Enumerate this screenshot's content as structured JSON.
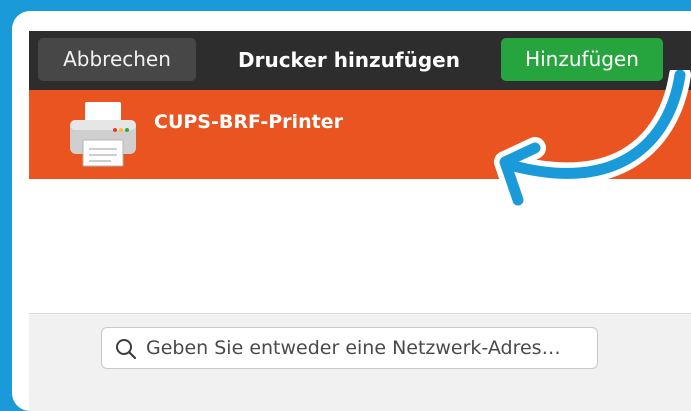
{
  "dialog": {
    "title": "Drucker hinzufügen",
    "cancel_label": "Abbrechen",
    "add_label": "Hinzufügen"
  },
  "printers": [
    {
      "name": "CUPS-BRF-Printer",
      "selected": true,
      "icon": "printer-icon"
    }
  ],
  "search": {
    "placeholder": "Geben Sie entweder eine Netzwerk-Adres…"
  },
  "colors": {
    "background": "#1a9ad9",
    "headerbar": "#2d2d2d",
    "selection": "#e95420",
    "add_button": "#26a53e",
    "annotation_arrow": "#1a9ad9"
  }
}
